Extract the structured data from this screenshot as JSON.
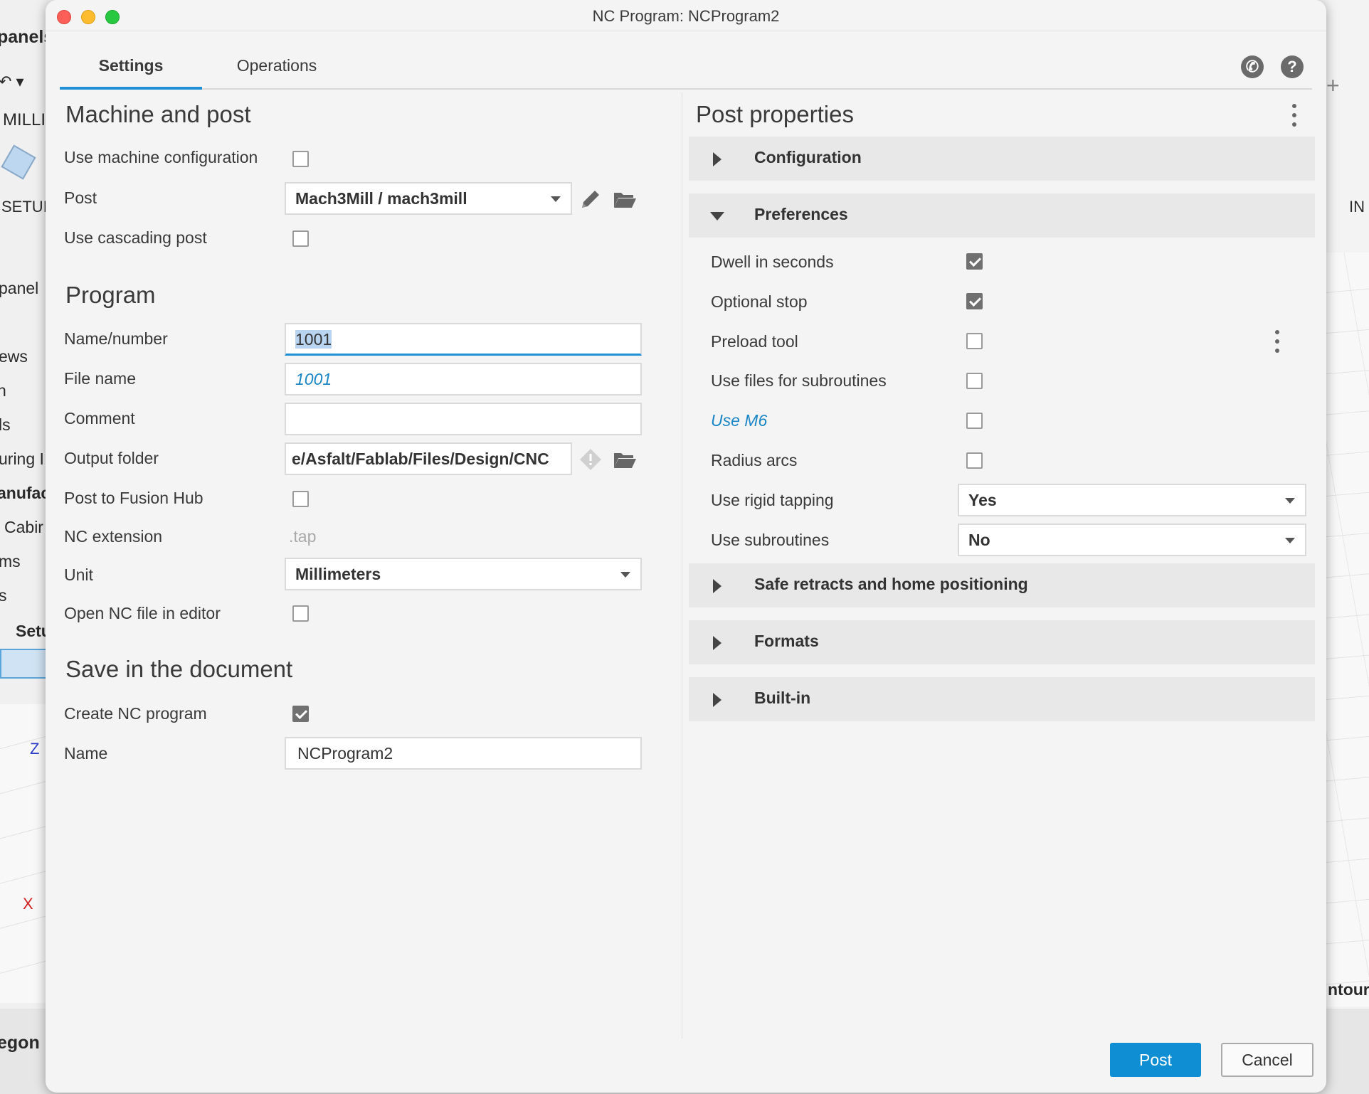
{
  "background_app": {
    "left_fragments": [
      "panels",
      "MILLI",
      "SETUI",
      "panel",
      "ews",
      "n",
      "ls",
      "uring I",
      "anufac",
      "Cabir",
      "ms",
      "s",
      "Setu",
      "egon"
    ],
    "right_fragments": [
      "IN",
      "ntour"
    ],
    "axis_labels": [
      "Z",
      "X"
    ]
  },
  "dialog": {
    "title": "NC Program: NCProgram2",
    "tabs": [
      {
        "label": "Settings",
        "active": true
      },
      {
        "label": "Operations",
        "active": false
      }
    ],
    "icons": [
      "phone-icon",
      "help-icon"
    ]
  },
  "machine_and_post": {
    "heading": "Machine and post",
    "use_machine_config_label": "Use machine configuration",
    "use_machine_config_checked": false,
    "post_label": "Post",
    "post_value": "Mach3Mill / mach3mill",
    "use_cascading_label": "Use cascading post",
    "use_cascading_checked": false
  },
  "program": {
    "heading": "Program",
    "name_number_label": "Name/number",
    "name_number_value": "1001",
    "file_name_label": "File name",
    "file_name_value": "1001",
    "comment_label": "Comment",
    "comment_value": "",
    "output_folder_label": "Output folder",
    "output_folder_value": "e/Asfalt/Fablab/Files/Design/CNC",
    "post_to_hub_label": "Post to Fusion Hub",
    "post_to_hub_checked": false,
    "nc_extension_label": "NC extension",
    "nc_extension_value": ".tap",
    "unit_label": "Unit",
    "unit_value": "Millimeters",
    "open_in_editor_label": "Open NC file in editor",
    "open_in_editor_checked": false
  },
  "save_in_document": {
    "heading": "Save in the document",
    "create_nc_label": "Create NC program",
    "create_nc_checked": true,
    "name_label": "Name",
    "name_value": "NCProgram2"
  },
  "post_properties": {
    "heading": "Post properties",
    "groups": {
      "configuration": "Configuration",
      "preferences": "Preferences",
      "safe_retracts": "Safe retracts and home positioning",
      "formats": "Formats",
      "built_in": "Built-in"
    },
    "preferences": {
      "dwell_label": "Dwell in seconds",
      "dwell_checked": true,
      "optional_stop_label": "Optional stop",
      "optional_stop_checked": true,
      "preload_tool_label": "Preload tool",
      "preload_tool_checked": false,
      "use_files_label": "Use files for subroutines",
      "use_files_checked": false,
      "use_m6_label": "Use M6",
      "use_m6_checked": false,
      "radius_arcs_label": "Radius arcs",
      "radius_arcs_checked": false,
      "rigid_tapping_label": "Use rigid tapping",
      "rigid_tapping_value": "Yes",
      "subroutines_label": "Use subroutines",
      "subroutines_value": "No"
    }
  },
  "footer": {
    "post_button": "Post",
    "cancel_button": "Cancel"
  },
  "colors": {
    "accent": "#1f8fd6",
    "post_button": "#0f8ed4",
    "modified_text": "#1a86c5"
  }
}
